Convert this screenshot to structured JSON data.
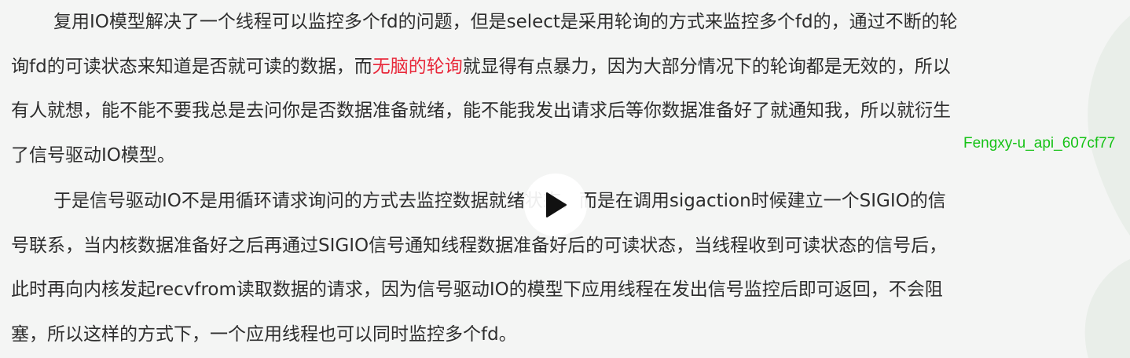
{
  "paragraph1": {
    "line1": "复用IO模型解决了一个线程可以监控多个fd的问题，但是select是采用轮询的方式来监控多个fd的，通过不断的轮",
    "line2_before": "询fd的可读状态来知道是否就可读的数据，而",
    "line2_highlight": "无脑的轮询",
    "line2_after": "就显得有点暴力，因为大部分情况下的轮询都是无效的，所以",
    "line3": "有人就想，能不能不要我总是去问你是否数据准备就绪，能不能我发出请求后等你数据准备好了就通知我，所以就衍生",
    "line4": "了信号驱动IO模型。"
  },
  "paragraph2": {
    "line1": "于是信号驱动IO不是用循环请求询问的方式去监控数据就绪状态，而是在调用sigaction时候建立一个SIGIO的信",
    "line2": "号联系，当内核数据准备好之后再通过SIGIO信号通知线程数据准备好后的可读状态，当线程收到可读状态的信号后，",
    "line3": "此时再向内核发起recvfrom读取数据的请求，因为信号驱动IO的模型下应用线程在发出信号监控后即可返回，不会阻",
    "line4": "塞，所以这样的方式下，一个应用线程也可以同时监控多个fd。"
  },
  "watermark": "Fengxy-u_api_607cf77",
  "play_button": {
    "icon": "play-icon"
  },
  "colors": {
    "background": "#f4f5f4",
    "text": "#2e2e2e",
    "highlight": "#e8283a",
    "watermark": "#16c216",
    "decor": "#e6ebe6"
  }
}
